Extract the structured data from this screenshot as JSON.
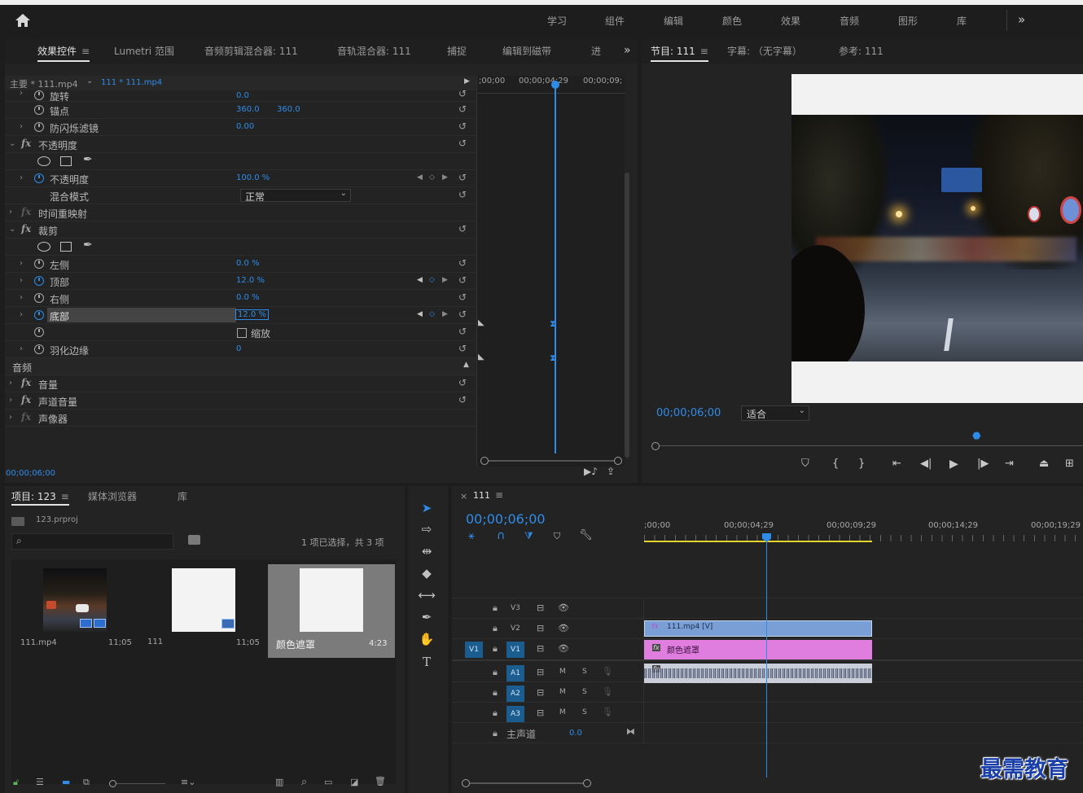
{
  "workspace_bar": {
    "tabs": [
      "学习",
      "组件",
      "编辑",
      "颜色",
      "效果",
      "音频",
      "图形",
      "库"
    ],
    "more": "»"
  },
  "effect_controls": {
    "tabs": [
      "效果控件",
      "Lumetri 范围",
      "音频剪辑混合器: 111",
      "音轨混合器: 111",
      "捕捉",
      "编辑到磁带",
      "进"
    ],
    "menu_glyph": "≡",
    "overflow": "»",
    "master_clip": "主要 * 111.mp4",
    "sequence_clip": "111 * 111.mp4",
    "time_labels": [
      ";00;00",
      "00;00;04;29",
      "00;00;09;"
    ],
    "current_time": "00;00;06;00",
    "rows": {
      "rotation": {
        "label": "旋转",
        "value": "0.0"
      },
      "anchor": {
        "label": "锚点",
        "value1": "360.0",
        "value2": "360.0"
      },
      "flicker": {
        "label": "防闪烁滤镜",
        "value": "0.00"
      },
      "opacity_group": {
        "label": "不透明度"
      },
      "opacity": {
        "label": "不透明度",
        "value": "100.0 %"
      },
      "blend_mode": {
        "label": "混合模式",
        "value": "正常"
      },
      "time_remap": {
        "label": "时间重映射"
      },
      "crop_group": {
        "label": "裁剪"
      },
      "left": {
        "label": "左侧",
        "value": "0.0 %"
      },
      "top": {
        "label": "顶部",
        "value": "12.0 %"
      },
      "right": {
        "label": "右侧",
        "value": "0.0 %"
      },
      "bottom": {
        "label": "底部",
        "value": "12.0 %"
      },
      "zoom": {
        "label": "缩放"
      },
      "feather": {
        "label": "羽化边缘",
        "value": "0"
      },
      "audio_section": {
        "label": "音频"
      },
      "volume": {
        "label": "音量"
      },
      "channel_volume": {
        "label": "声道音量"
      },
      "panner": {
        "label": "声像器"
      }
    }
  },
  "program_monitor": {
    "tabs": [
      "节目: 111",
      "字幕: （无字幕）",
      "参考: 111"
    ],
    "menu_glyph": "≡",
    "timecode": "00;00;06;00",
    "fit": "适合"
  },
  "project_panel": {
    "tabs": [
      "项目: 123",
      "媒体浏览器",
      "库"
    ],
    "menu_glyph": "≡",
    "project_file": "123.prproj",
    "selection_status": "1 项已选择，共 3 项",
    "items": [
      {
        "name": "111.mp4",
        "duration": "11;05"
      },
      {
        "name": "111",
        "duration": "11;05"
      },
      {
        "name": "颜色遮罩",
        "duration": "4:23"
      }
    ]
  },
  "timeline": {
    "close": "×",
    "sequence_name": "111",
    "menu_glyph": "≡",
    "timecode": "00;00;06;00",
    "ruler_labels": [
      ";00;00",
      "00;00;04;29",
      "00;00;09;29",
      "00;00;14;29",
      "00;00;19;29"
    ],
    "tracks": {
      "v3": "V3",
      "v2": "V2",
      "v1": "V1",
      "v1_source": "V1",
      "a1": "A1",
      "a2": "A2",
      "a3": "A3",
      "mute": "M",
      "solo": "S"
    },
    "master": {
      "label": "主声道",
      "value": "0.0"
    },
    "clips": {
      "v2_clip": "111.mp4 [V]",
      "v1_clip": "颜色遮罩",
      "fx_badge": "fx"
    }
  },
  "watermark": "最需教育",
  "colors": {
    "accent_blue": "#2e8ce8",
    "video_clip": "#7a9fd6",
    "matte_clip": "#e07ee0",
    "audio_clip": "#c9ced8",
    "work_area": "#e6d32a"
  }
}
